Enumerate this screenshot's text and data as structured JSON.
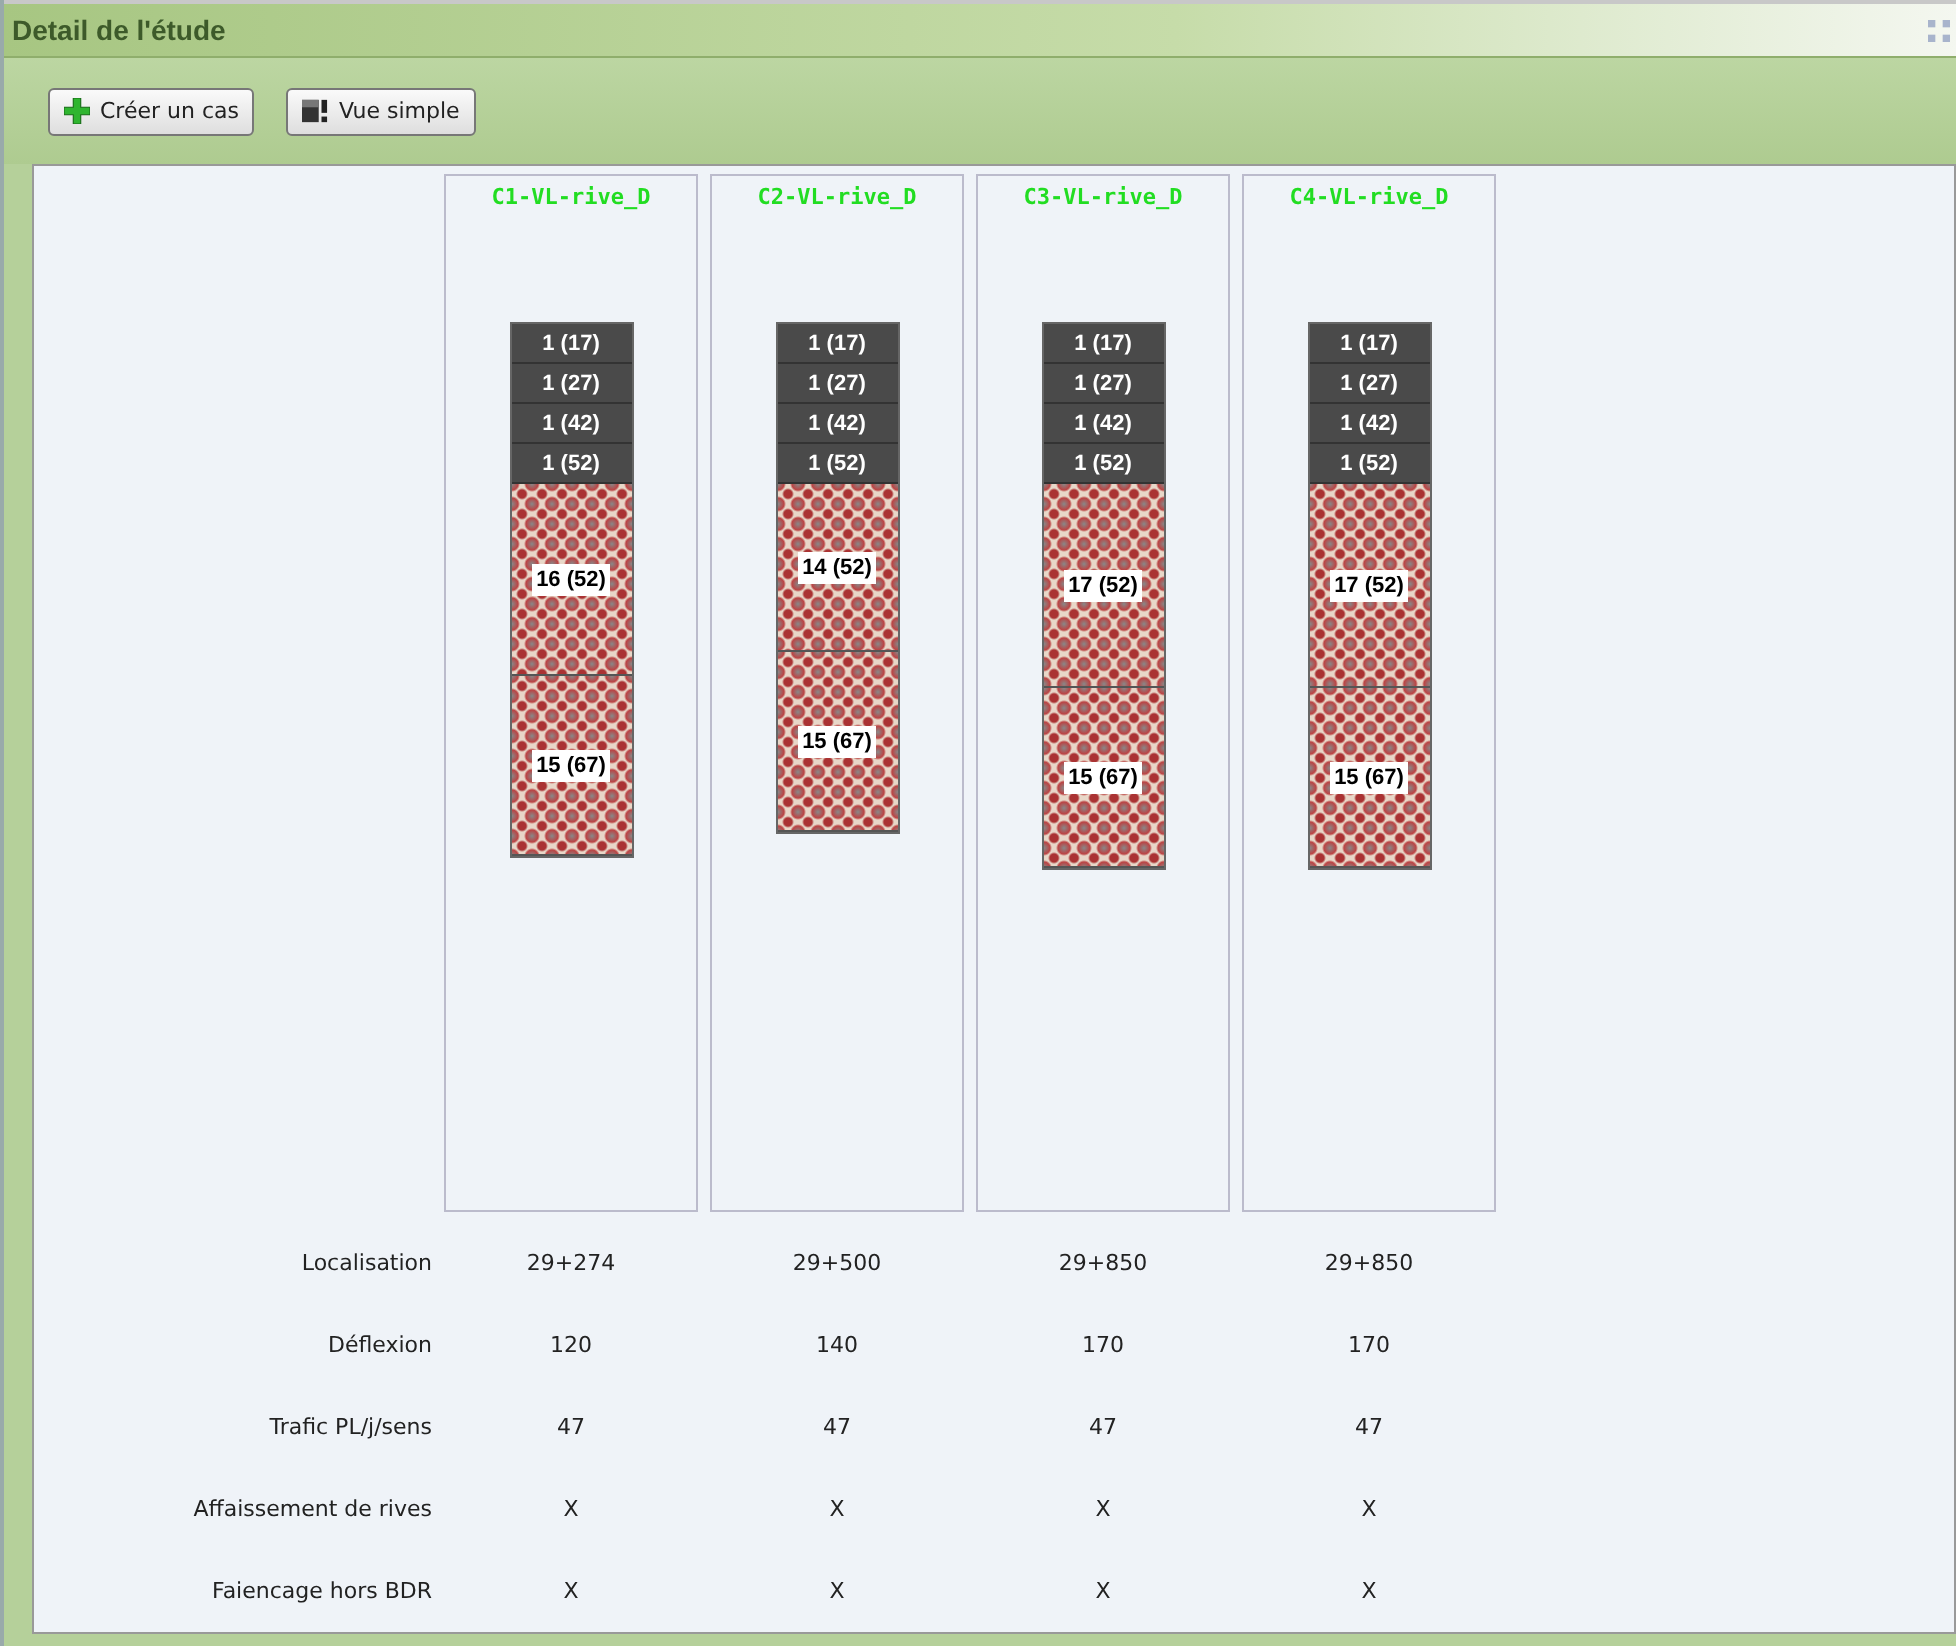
{
  "window": {
    "title": "Detail de l'étude"
  },
  "toolbar": [
    {
      "label": "Créer un cas",
      "kind": "create"
    },
    {
      "label": "Vue simple",
      "kind": "view"
    }
  ],
  "cases": [
    {
      "title": "C1-VL-rive_D",
      "layers": [
        {
          "label": "1 (17)",
          "kind": "surface"
        },
        {
          "label": "1 (27)",
          "kind": "surface"
        },
        {
          "label": "1 (42)",
          "kind": "surface"
        },
        {
          "label": "1 (52)",
          "kind": "surface"
        },
        {
          "label": "16 (52)",
          "kind": "base"
        },
        {
          "label": "15 (67)",
          "kind": "base"
        }
      ]
    },
    {
      "title": "C2-VL-rive_D",
      "layers": [
        {
          "label": "1 (17)",
          "kind": "surface"
        },
        {
          "label": "1 (27)",
          "kind": "surface"
        },
        {
          "label": "1 (42)",
          "kind": "surface"
        },
        {
          "label": "1 (52)",
          "kind": "surface"
        },
        {
          "label": "14 (52)",
          "kind": "base"
        },
        {
          "label": "15 (67)",
          "kind": "base"
        }
      ]
    },
    {
      "title": "C3-VL-rive_D",
      "layers": [
        {
          "label": "1 (17)",
          "kind": "surface"
        },
        {
          "label": "1 (27)",
          "kind": "surface"
        },
        {
          "label": "1 (42)",
          "kind": "surface"
        },
        {
          "label": "1 (52)",
          "kind": "surface"
        },
        {
          "label": "17 (52)",
          "kind": "base"
        },
        {
          "label": "15 (67)",
          "kind": "base"
        }
      ]
    },
    {
      "title": "C4-VL-rive_D",
      "layers": [
        {
          "label": "1 (17)",
          "kind": "surface"
        },
        {
          "label": "1 (27)",
          "kind": "surface"
        },
        {
          "label": "1 (42)",
          "kind": "surface"
        },
        {
          "label": "1 (52)",
          "kind": "surface"
        },
        {
          "label": "17 (52)",
          "kind": "base"
        },
        {
          "label": "15 (67)",
          "kind": "base"
        }
      ]
    }
  ],
  "properties": [
    {
      "label": "Localisation",
      "values": [
        "29+274",
        "29+500",
        "29+850",
        "29+850"
      ]
    },
    {
      "label": "Déflexion",
      "values": [
        "120",
        "140",
        "170",
        "170"
      ]
    },
    {
      "label": "Trafic PL/j/sens",
      "values": [
        "47",
        "47",
        "47",
        "47"
      ]
    },
    {
      "label": "Affaissement de rives",
      "values": [
        "X",
        "X",
        "X",
        "X"
      ]
    },
    {
      "label": "Faiencage hors BDR",
      "values": [
        "X",
        "X",
        "X",
        "X"
      ]
    }
  ]
}
